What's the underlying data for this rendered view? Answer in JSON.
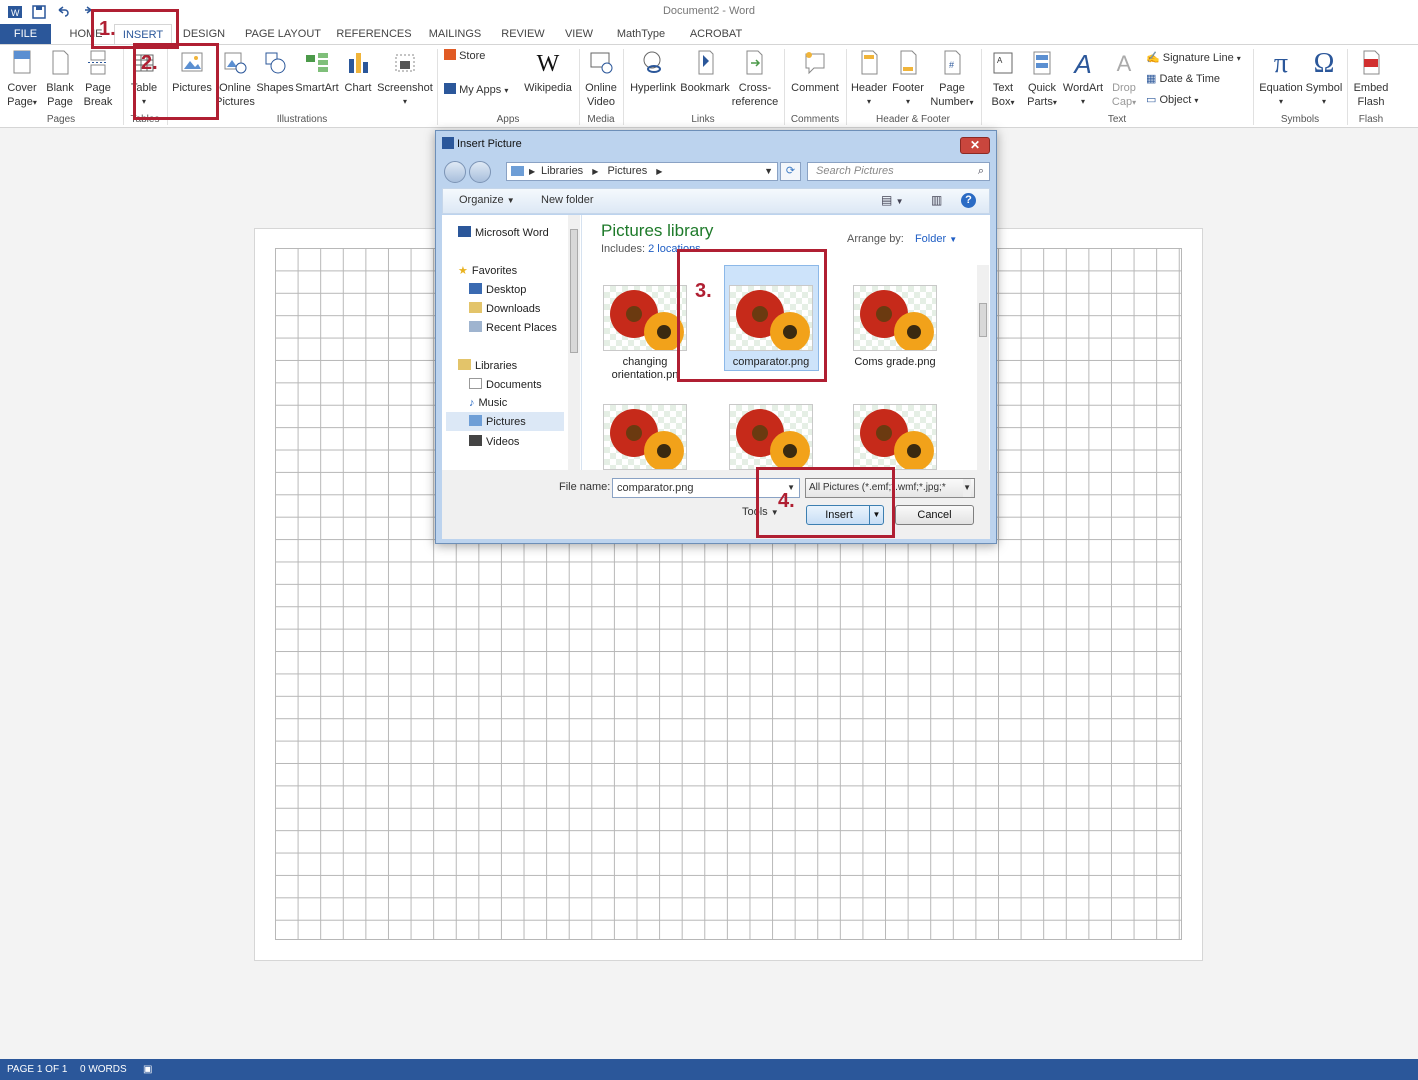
{
  "window": {
    "title": "Document2 - Word"
  },
  "tabs": {
    "file": "FILE",
    "home": "HOME",
    "insert": "INSERT",
    "design": "DESIGN",
    "page_layout": "PAGE LAYOUT",
    "references": "REFERENCES",
    "mailings": "MAILINGS",
    "review": "REVIEW",
    "view": "VIEW",
    "mathtype": "MathType",
    "acrobat": "ACROBAT"
  },
  "ribbon": {
    "pages": {
      "cover": [
        "Cover",
        "Page"
      ],
      "blank": [
        "Blank",
        "Page"
      ],
      "break": [
        "Page",
        "Break"
      ],
      "label": "Pages"
    },
    "tables": {
      "table": "Table",
      "label": "Tables"
    },
    "illustrations": {
      "pictures": "Pictures",
      "online_pictures": [
        "Online",
        "Pictures"
      ],
      "shapes": "Shapes",
      "smartart": "SmartArt",
      "chart": "Chart",
      "screenshot": "Screenshot",
      "label": "Illustrations"
    },
    "apps": {
      "store": "Store",
      "my_apps": "My Apps",
      "wikipedia": "Wikipedia",
      "label": "Apps"
    },
    "media": {
      "online_video": [
        "Online",
        "Video"
      ],
      "label": "Media"
    },
    "links": {
      "hyperlink": "Hyperlink",
      "bookmark": "Bookmark",
      "cross_ref": [
        "Cross-",
        "reference"
      ],
      "label": "Links"
    },
    "comments": {
      "comment": "Comment",
      "label": "Comments"
    },
    "header_footer": {
      "header": "Header",
      "footer": "Footer",
      "page_number": [
        "Page",
        "Number"
      ],
      "label": "Header & Footer"
    },
    "text": {
      "text_box": [
        "Text",
        "Box"
      ],
      "quick_parts": [
        "Quick",
        "Parts"
      ],
      "wordart": "WordArt",
      "drop_cap": [
        "Drop",
        "Cap"
      ],
      "signature_line": "Signature Line",
      "date_time": "Date & Time",
      "object": "Object",
      "label": "Text"
    },
    "symbols": {
      "equation": "Equation",
      "symbol": "Symbol",
      "label": "Symbols"
    },
    "flash": {
      "embed": [
        "Embed",
        "Flash"
      ],
      "label": "Flash"
    }
  },
  "status": {
    "page": "PAGE 1 OF 1",
    "words": "0 WORDS"
  },
  "dialog": {
    "title": "Insert Picture",
    "address": [
      "Libraries",
      "Pictures"
    ],
    "search_placeholder": "Search Pictures",
    "organize": "Organize",
    "new_folder": "New folder",
    "library_title": "Pictures library",
    "includes_label": "Includes:",
    "includes_link": "2 locations",
    "arrange_by_label": "Arrange by:",
    "arrange_by_value": "Folder",
    "nav": {
      "word": "Microsoft Word",
      "favorites": "Favorites",
      "desktop": "Desktop",
      "downloads": "Downloads",
      "recent": "Recent Places",
      "libraries": "Libraries",
      "documents": "Documents",
      "music": "Music",
      "pictures": "Pictures",
      "videos": "Videos"
    },
    "files": [
      {
        "name": [
          "changing",
          "orientation.pn"
        ]
      },
      {
        "name": [
          "comparator.png"
        ]
      },
      {
        "name": [
          "Coms grade.png"
        ]
      }
    ],
    "filename_label": "File name:",
    "filename_value": "comparator.png",
    "filetype": "All Pictures (*.emf;*.wmf;*.jpg;*",
    "tools": "Tools",
    "insert": "Insert",
    "cancel": "Cancel"
  },
  "annotations": {
    "step1": "1.",
    "step2": "2.",
    "step3": "3.",
    "step4": "4."
  },
  "colors": {
    "accent": "#2b579a",
    "annotation": "#b01f32"
  }
}
